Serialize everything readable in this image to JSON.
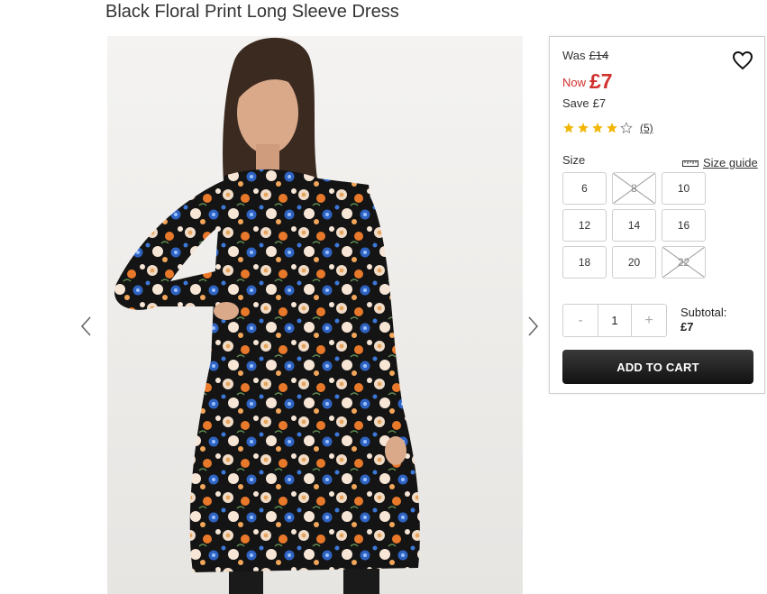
{
  "product": {
    "title": "Black Floral Print Long Sleeve Dress",
    "image_alt": "Model wearing black floral print long sleeve dress"
  },
  "pricing": {
    "was_label": "Was",
    "was_price": "£14",
    "now_label": "Now",
    "now_price": "£7",
    "save_label": "Save",
    "save_amount": "£7"
  },
  "rating": {
    "stars": 4,
    "max": 5,
    "review_count": "(5)"
  },
  "size": {
    "label": "Size",
    "guide_label": "Size guide",
    "options": [
      {
        "label": "6",
        "available": true
      },
      {
        "label": "8",
        "available": false
      },
      {
        "label": "10",
        "available": true
      },
      {
        "label": "12",
        "available": true
      },
      {
        "label": "14",
        "available": true
      },
      {
        "label": "16",
        "available": true
      },
      {
        "label": "18",
        "available": true
      },
      {
        "label": "20",
        "available": true
      },
      {
        "label": "22",
        "available": false
      }
    ]
  },
  "quantity": {
    "minus": "-",
    "value": "1",
    "plus": "+"
  },
  "subtotal": {
    "label": "Subtotal:",
    "amount": "£7"
  },
  "cart": {
    "add_label": "ADD TO CART"
  },
  "colors": {
    "sale_red": "#d0312d",
    "star_gold": "#f2b705",
    "button_dark": "#1c1c1c"
  },
  "icons": {
    "wishlist": "heart-icon",
    "size_guide": "ruler-icon",
    "prev": "chevron-left-icon",
    "next": "chevron-right-icon"
  }
}
